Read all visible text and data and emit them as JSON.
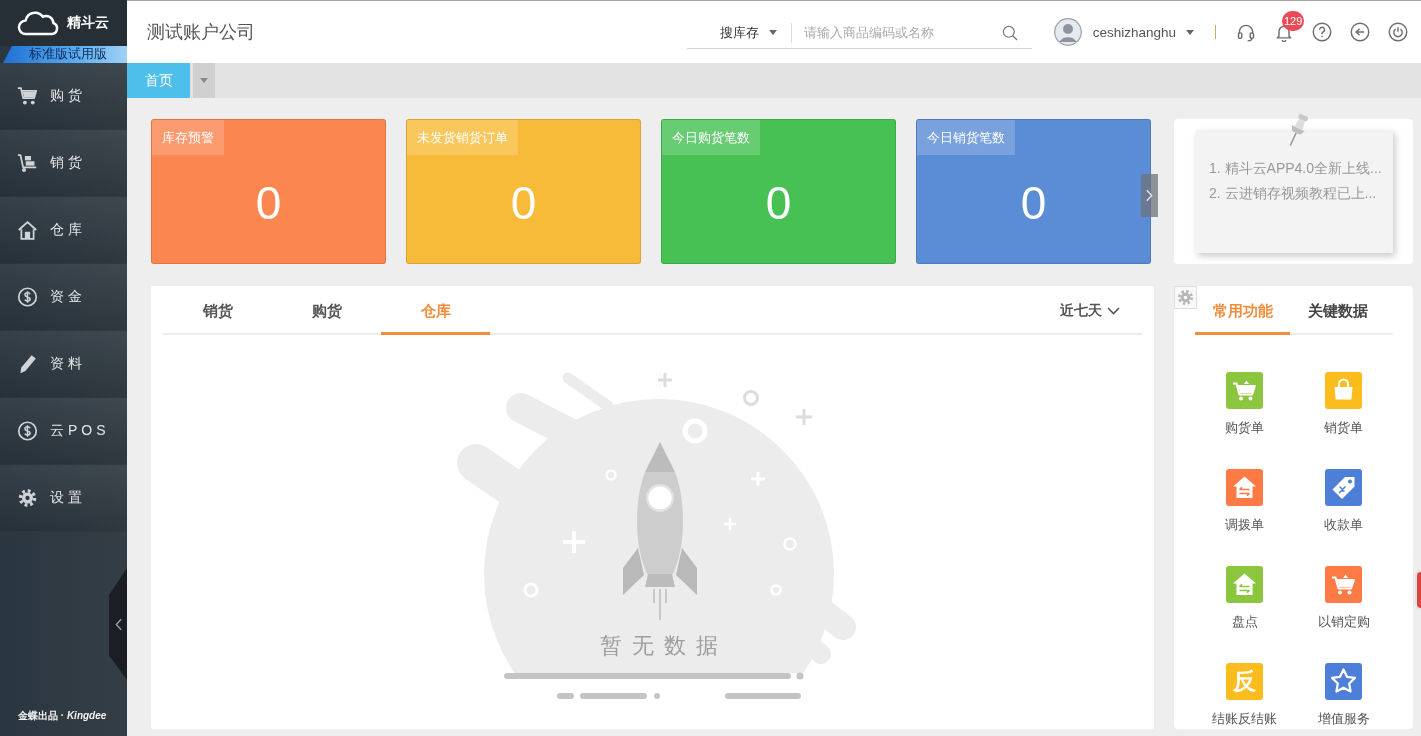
{
  "sidebar": {
    "logo": "精斗云",
    "edition": "标准版试用版",
    "items": [
      {
        "label": "购货"
      },
      {
        "label": "销货"
      },
      {
        "label": "仓库"
      },
      {
        "label": "资金"
      },
      {
        "label": "资料"
      },
      {
        "label": "云POS"
      },
      {
        "label": "设置"
      }
    ],
    "footer": "金蝶出品 · *Kingdee*"
  },
  "header": {
    "company": "测试账户公司",
    "search_scope": "搜库存",
    "search": {
      "placeholder": "请输入商品编码或名称"
    },
    "user": "ceshizhanghu",
    "notification_count": "129"
  },
  "page_tabs": [
    {
      "label": "首页",
      "selected": true
    }
  ],
  "stats": [
    {
      "label": "库存预警",
      "value": "0",
      "color": "#fc8650"
    },
    {
      "label": "未发货销货订单",
      "value": "0",
      "color": "#f8bb39"
    },
    {
      "label": "今日购货笔数",
      "value": "0",
      "color": "#47c153"
    },
    {
      "label": "今日销货笔数",
      "value": "0",
      "color": "#5b8dd7"
    }
  ],
  "notices": [
    "1. 精斗云APP4.0全新上线...",
    "2. 云进销存视频教程已上..."
  ],
  "chart_panel": {
    "tabs": [
      {
        "label": "销货",
        "selected": false
      },
      {
        "label": "购货",
        "selected": false
      },
      {
        "label": "仓库",
        "selected": true
      }
    ],
    "range": "近七天",
    "empty_text": "暂 无 数 据"
  },
  "quick_panel": {
    "tabs": [
      {
        "label": "常用功能",
        "selected": true
      },
      {
        "label": "关键数据",
        "selected": false
      }
    ],
    "items": [
      {
        "label": "购货单",
        "color": "#8cc63e"
      },
      {
        "label": "销货单",
        "color": "#fbbc1d"
      },
      {
        "label": "调拨单",
        "color": "#fd7a45"
      },
      {
        "label": "收款单",
        "color": "#4d7fd8"
      },
      {
        "label": "盘点",
        "color": "#8cc63e"
      },
      {
        "label": "以销定购",
        "color": "#fd7a45"
      },
      {
        "label": "结账反结账",
        "color": "#fbbc1d",
        "glyph": "反"
      },
      {
        "label": "增值服务",
        "color": "#4d7fd8"
      }
    ]
  }
}
